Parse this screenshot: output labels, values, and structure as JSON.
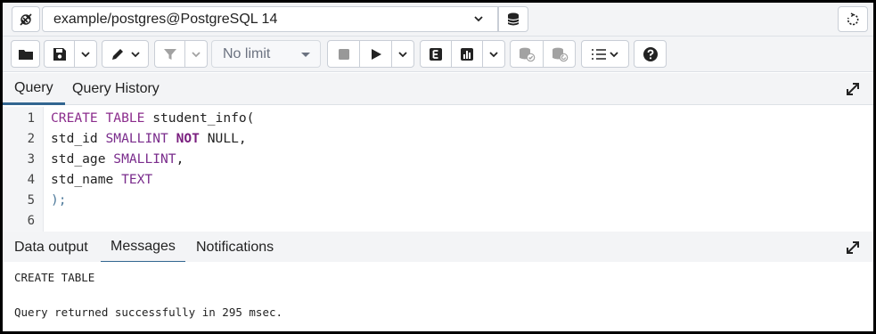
{
  "connection": {
    "label": "example/postgres@PostgreSQL 14"
  },
  "toolbar": {
    "limit_value": "No limit"
  },
  "editor_tabs": [
    {
      "label": "Query"
    },
    {
      "label": "Query History"
    }
  ],
  "editor": {
    "lines": [
      {
        "n": "1",
        "tokens": [
          {
            "t": "CREATE",
            "c": "kw"
          },
          {
            "t": " ",
            "c": ""
          },
          {
            "t": "TABLE",
            "c": "kw"
          },
          {
            "t": " student_info(",
            "c": ""
          }
        ]
      },
      {
        "n": "2",
        "tokens": [
          {
            "t": "std_id ",
            "c": ""
          },
          {
            "t": "SMALLINT",
            "c": "ty"
          },
          {
            "t": " ",
            "c": ""
          },
          {
            "t": "NOT",
            "c": "kw-b"
          },
          {
            "t": " NULL,",
            "c": ""
          }
        ]
      },
      {
        "n": "3",
        "tokens": [
          {
            "t": "std_age ",
            "c": ""
          },
          {
            "t": "SMALLINT",
            "c": "ty"
          },
          {
            "t": ",",
            "c": ""
          }
        ]
      },
      {
        "n": "4",
        "tokens": [
          {
            "t": "std_name ",
            "c": ""
          },
          {
            "t": "TEXT",
            "c": "ty"
          }
        ]
      },
      {
        "n": "5",
        "tokens": [
          {
            "t": ");",
            "c": "pu"
          }
        ]
      },
      {
        "n": "6",
        "tokens": []
      }
    ]
  },
  "result_tabs": [
    {
      "label": "Data output"
    },
    {
      "label": "Messages"
    },
    {
      "label": "Notifications"
    }
  ],
  "messages": {
    "line1": "CREATE TABLE",
    "line2": "Query returned successfully in 295 msec."
  },
  "colors": {
    "accent": "#326690",
    "keyword": "#8b2c8c"
  }
}
